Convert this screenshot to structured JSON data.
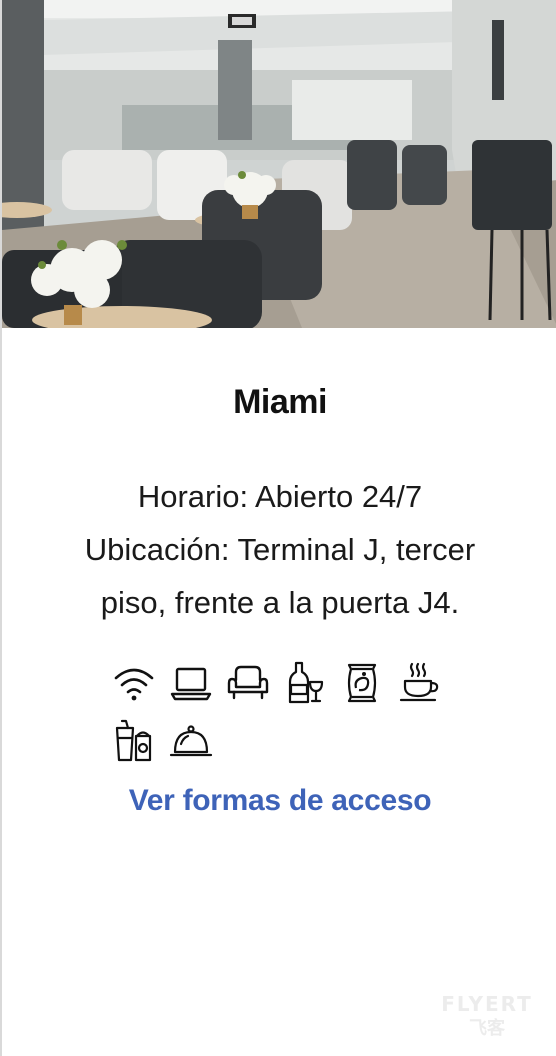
{
  "lounge": {
    "title": "Miami",
    "hours_line": "Horario: Abierto 24/7",
    "location_line1": "Ubicación: Terminal J, tercer",
    "location_line2": "piso, frente a la puerta J4."
  },
  "amenities": {
    "row1": [
      "wifi-icon",
      "laptop-icon",
      "armchair-icon",
      "wine-bottle-glass-icon",
      "snack-bag-icon",
      "coffee-cup-icon"
    ],
    "row2": [
      "soft-drinks-icon",
      "food-cloche-icon"
    ]
  },
  "cta": {
    "label": "Ver formas de acceso"
  },
  "watermark": {
    "line1": "FLYERT",
    "line2": "飞客"
  },
  "colors": {
    "accent": "#3e63b8",
    "text": "#1a1a1a"
  }
}
